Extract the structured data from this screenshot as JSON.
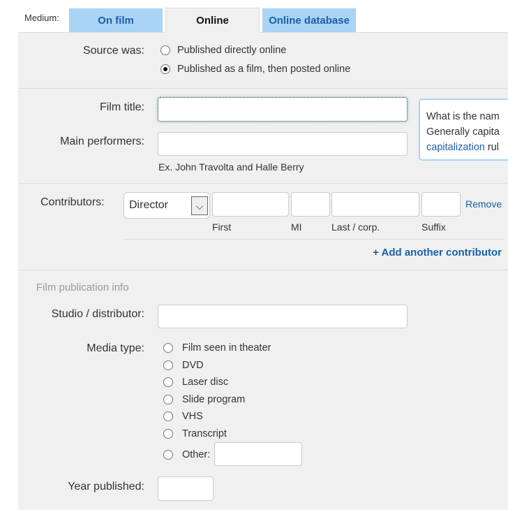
{
  "medium": {
    "label": "Medium:",
    "tabs": [
      {
        "label": "On film"
      },
      {
        "label": "Online"
      },
      {
        "label": "Online database"
      }
    ]
  },
  "source": {
    "label": "Source was:",
    "options": [
      {
        "label": "Published directly online",
        "checked": false
      },
      {
        "label": "Published as a film, then posted online",
        "checked": true
      }
    ]
  },
  "film_title": {
    "label": "Film title:",
    "value": ""
  },
  "main_performers": {
    "label": "Main performers:",
    "value": "",
    "hint": "Ex. John Travolta and Halle Berry"
  },
  "tooltip": {
    "line1": "What is the nam",
    "line2": "Generally capita",
    "link": "capitalization",
    "line3_rest": " rul"
  },
  "contributors": {
    "label": "Contributors:",
    "role": "Director",
    "first_label": "First",
    "mi_label": "MI",
    "last_label": "Last / corp.",
    "suffix_label": "Suffix",
    "remove": "Remove",
    "add": "+ Add another contributor"
  },
  "publication": {
    "heading": "Film publication info",
    "studio_label": "Studio / distributor:",
    "media_label": "Media type:",
    "media_options": [
      "Film seen in theater",
      "DVD",
      "Laser disc",
      "Slide program",
      "VHS",
      "Transcript",
      "Other:"
    ],
    "year_label": "Year published:"
  },
  "colors": {
    "accent": "#1a5fa8",
    "tab_bg": "#a9d4f5",
    "panel": "#f0f0f0"
  }
}
